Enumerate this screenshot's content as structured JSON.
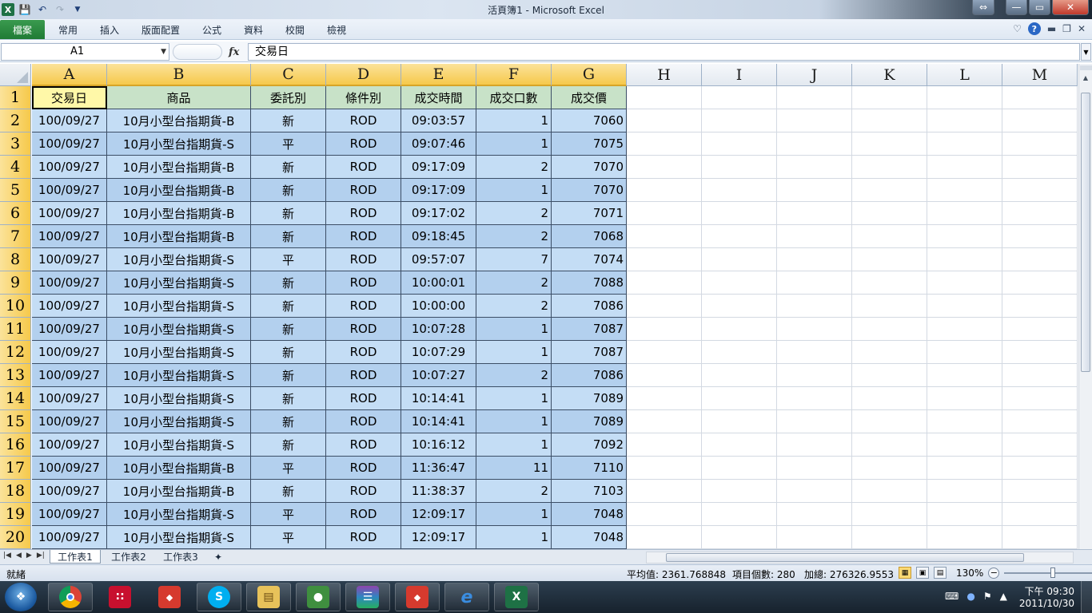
{
  "window": {
    "title": "活頁簿1 - Microsoft Excel",
    "excel_icon": "X",
    "controls": [
      "⇔",
      "—",
      "▭",
      "✕"
    ]
  },
  "ribbon": {
    "file_tab": "檔案",
    "tabs": [
      "常用",
      "插入",
      "版面配置",
      "公式",
      "資料",
      "校閱",
      "檢視"
    ]
  },
  "formula_bar": {
    "name_box": "A1",
    "fx": "fx",
    "value": "交易日"
  },
  "grid": {
    "columns": [
      "A",
      "B",
      "C",
      "D",
      "E",
      "F",
      "G",
      "H",
      "I",
      "J",
      "K",
      "L",
      "M"
    ],
    "rows": [
      "1",
      "2",
      "3",
      "4",
      "5",
      "6",
      "7",
      "8",
      "9",
      "10",
      "11",
      "12",
      "13",
      "14",
      "15",
      "16",
      "17",
      "18",
      "19",
      "20"
    ],
    "header_row": [
      "交易日",
      "商品",
      "委託別",
      "條件別",
      "成交時間",
      "成交口數",
      "成交價"
    ],
    "data_rows": [
      [
        "100/09/27",
        "10月小型台指期貨-B",
        "新",
        "ROD",
        "09:03:57",
        "1",
        "7060"
      ],
      [
        "100/09/27",
        "10月小型台指期貨-S",
        "平",
        "ROD",
        "09:07:46",
        "1",
        "7075"
      ],
      [
        "100/09/27",
        "10月小型台指期貨-B",
        "新",
        "ROD",
        "09:17:09",
        "2",
        "7070"
      ],
      [
        "100/09/27",
        "10月小型台指期貨-B",
        "新",
        "ROD",
        "09:17:09",
        "1",
        "7070"
      ],
      [
        "100/09/27",
        "10月小型台指期貨-B",
        "新",
        "ROD",
        "09:17:02",
        "2",
        "7071"
      ],
      [
        "100/09/27",
        "10月小型台指期貨-B",
        "新",
        "ROD",
        "09:18:45",
        "2",
        "7068"
      ],
      [
        "100/09/27",
        "10月小型台指期貨-S",
        "平",
        "ROD",
        "09:57:07",
        "7",
        "7074"
      ],
      [
        "100/09/27",
        "10月小型台指期貨-S",
        "新",
        "ROD",
        "10:00:01",
        "2",
        "7088"
      ],
      [
        "100/09/27",
        "10月小型台指期貨-S",
        "新",
        "ROD",
        "10:00:00",
        "2",
        "7086"
      ],
      [
        "100/09/27",
        "10月小型台指期貨-S",
        "新",
        "ROD",
        "10:07:28",
        "1",
        "7087"
      ],
      [
        "100/09/27",
        "10月小型台指期貨-S",
        "新",
        "ROD",
        "10:07:29",
        "1",
        "7087"
      ],
      [
        "100/09/27",
        "10月小型台指期貨-S",
        "新",
        "ROD",
        "10:07:27",
        "2",
        "7086"
      ],
      [
        "100/09/27",
        "10月小型台指期貨-S",
        "新",
        "ROD",
        "10:14:41",
        "1",
        "7089"
      ],
      [
        "100/09/27",
        "10月小型台指期貨-S",
        "新",
        "ROD",
        "10:14:41",
        "1",
        "7089"
      ],
      [
        "100/09/27",
        "10月小型台指期貨-S",
        "新",
        "ROD",
        "10:16:12",
        "1",
        "7092"
      ],
      [
        "100/09/27",
        "10月小型台指期貨-B",
        "平",
        "ROD",
        "11:36:47",
        "11",
        "7110"
      ],
      [
        "100/09/27",
        "10月小型台指期貨-B",
        "新",
        "ROD",
        "11:38:37",
        "2",
        "7103"
      ],
      [
        "100/09/27",
        "10月小型台指期貨-S",
        "平",
        "ROD",
        "12:09:17",
        "1",
        "7048"
      ],
      [
        "100/09/27",
        "10月小型台指期貨-S",
        "平",
        "ROD",
        "12:09:17",
        "1",
        "7048"
      ]
    ],
    "column_align": [
      "c",
      "c",
      "c",
      "c",
      "c",
      "r",
      "r"
    ]
  },
  "sheets": {
    "tabs": [
      "工作表1",
      "工作表2",
      "工作表3"
    ],
    "active": "工作表1"
  },
  "status": {
    "ready": "就緒",
    "average": "平均值: 2361.768848",
    "count": "項目個數: 280",
    "sum": "加總: 276326.9553",
    "zoom": "130%"
  },
  "taskbar": {
    "time": "下午 09:30",
    "date": "2011/10/30",
    "apps": [
      "chrome-icon",
      "app-red-icon",
      "app-red-icon-2",
      "skype-icon",
      "file-explorer-icon",
      "network-icon",
      "winrar-icon",
      "app-red-icon-3",
      "ie-icon",
      "excel-icon"
    ]
  },
  "colors": {
    "data_fill": "#c4ddf5",
    "header_fill": "#c8e2c8",
    "a1_fill": "#fff8a8",
    "selected_header": "#f6c94b",
    "file_tab": "#1f7b34"
  }
}
